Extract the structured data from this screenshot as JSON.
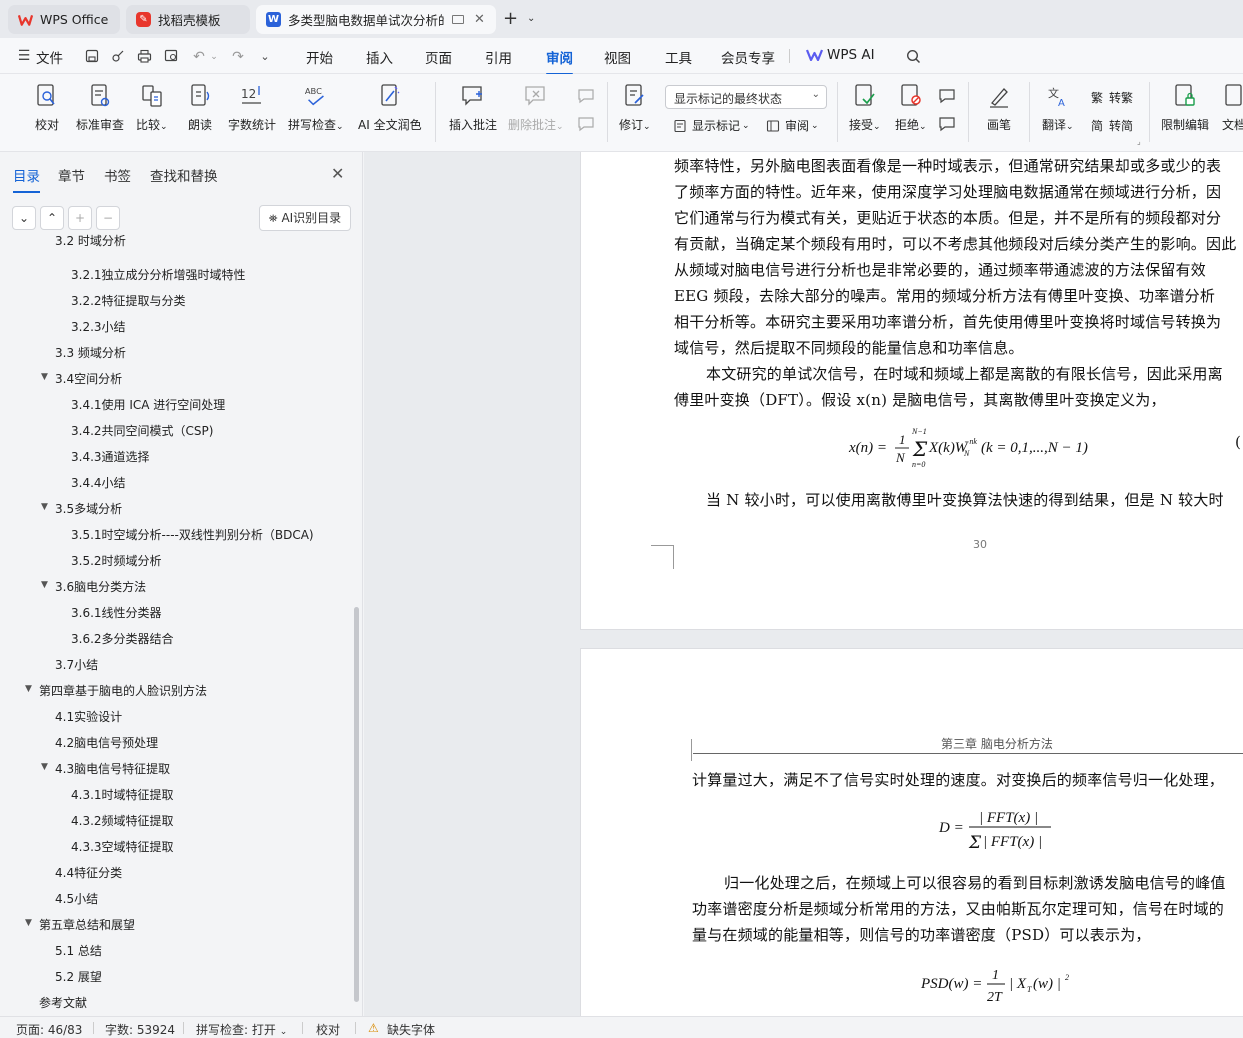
{
  "tabs": [
    {
      "label": "WPS Office",
      "icon": "wps-logo-icon"
    },
    {
      "label": "找稻壳模板",
      "icon": "docer-icon"
    },
    {
      "label": "多类型脑电数据单试次分析的",
      "icon": "word-doc-icon"
    }
  ],
  "menu": {
    "file": "文件",
    "items": [
      "开始",
      "插入",
      "页面",
      "引用",
      "审阅",
      "视图",
      "工具",
      "会员专享"
    ],
    "active": "审阅",
    "wps_ai": "WPS AI"
  },
  "ribbon": {
    "proofread": "校对",
    "standard_review": "标准审查",
    "compare": "比较",
    "read_aloud": "朗读",
    "word_count": "字数统计",
    "spell_check": "拼写检查",
    "ai_polish": "AI 全文润色",
    "insert_comment": "插入批注",
    "delete_comment": "删除批注",
    "revise": "修订",
    "display_select": "显示标记的最终状态",
    "show_marks": "显示标记",
    "review": "审阅",
    "accept": "接受",
    "reject": "拒绝",
    "pen": "画笔",
    "translate": "翻译",
    "to_traditional": "转繁",
    "to_simplified": "转简",
    "restrict_edit": "限制编辑",
    "doc_right": "文档"
  },
  "panel": {
    "tabs": [
      "目录",
      "章节",
      "书签",
      "查找和替换"
    ],
    "ai_toc": "AI识别目录",
    "toc": [
      {
        "text": "3.2 时域分析",
        "level": 2,
        "caret": false,
        "clipped": true
      },
      {
        "text": "3.2.1独立成分分析增强时域特性",
        "level": 3
      },
      {
        "text": "3.2.2特征提取与分类",
        "level": 3
      },
      {
        "text": "3.2.3小结",
        "level": 3
      },
      {
        "text": "3.3  频域分析",
        "level": 2
      },
      {
        "text": "3.4空间分析",
        "level": 2,
        "caret": true
      },
      {
        "text": "3.4.1使用 ICA 进行空间处理",
        "level": 3
      },
      {
        "text": "3.4.2共同空间模式（CSP)",
        "level": 3
      },
      {
        "text": "3.4.3通道选择",
        "level": 3
      },
      {
        "text": "3.4.4小结",
        "level": 3
      },
      {
        "text": "3.5多域分析",
        "level": 2,
        "caret": true
      },
      {
        "text": "3.5.1时空域分析----双线性判别分析（BDCA)",
        "level": 3
      },
      {
        "text": "3.5.2时频域分析",
        "level": 3
      },
      {
        "text": "3.6脑电分类方法",
        "level": 2,
        "caret": true
      },
      {
        "text": "3.6.1线性分类器",
        "level": 3
      },
      {
        "text": "3.6.2多分类器结合",
        "level": 3
      },
      {
        "text": "3.7小结",
        "level": 2
      },
      {
        "text": "第四章基于脑电的人脸识别方法",
        "level": 1,
        "caret": true
      },
      {
        "text": "4.1实验设计",
        "level": 2
      },
      {
        "text": "4.2脑电信号预处理",
        "level": 2
      },
      {
        "text": "4.3脑电信号特征提取",
        "level": 2,
        "caret": true
      },
      {
        "text": "4.3.1时域特征提取",
        "level": 3
      },
      {
        "text": "4.3.2频域特征提取",
        "level": 3
      },
      {
        "text": "4.3.3空域特征提取",
        "level": 3
      },
      {
        "text": "4.4特征分类",
        "level": 2
      },
      {
        "text": "4.5小结",
        "level": 2
      },
      {
        "text": "第五章总结和展望",
        "level": 1,
        "caret": true
      },
      {
        "text": "5.1  总结",
        "level": 2
      },
      {
        "text": "5.2  展望",
        "level": 2
      },
      {
        "text": "参考文献",
        "level": 1
      }
    ]
  },
  "doc": {
    "page1_lines": [
      "频率特性，另外脑电图表面看像是一种时域表示，但通常研究结果却或多或少的表",
      "了频率方面的特性。近年来，使用深度学习处理脑电数据通常在频域进行分析，因",
      "它们通常与行为模式有关，更贴近于状态的本质。但是，并不是所有的频段都对分",
      "有贡献，当确定某个频段有用时，可以不考虑其他频段对后续分类产生的影响。因此",
      "从频域对脑电信号进行分析也是非常必要的，通过频率带通滤波的方法保留有效",
      "EEG 频段，去除大部分的噪声。常用的频域分析方法有傅里叶变换、功率谱分析",
      "相干分析等。本研究主要采用功率谱分析，首先使用傅里叶变换将时域信号转换为",
      "域信号，然后提取不同频段的能量信息和功率信息。",
      "本文研究的单试次信号，在时域和频域上都是离散的有限长信号，因此采用离",
      "傅里叶变换（DFT）。假设 x(n) 是脑电信号，其离散傅里叶变换定义为，"
    ],
    "formula1": "x(n) = 1/N Σ X(k)W_N^-nk (k = 0,1,...,N−1)",
    "formula1_num": "(",
    "page1_after": "当 N 较小时，可以使用离散傅里叶变换算法快速的得到结果，但是 N 较大时",
    "page_number": "30",
    "page2_header": "第三章  脑电分析方法",
    "page2_line1": "计算量过大，满足不了信号实时处理的速度。对变换后的频率信号归一化处理，",
    "formula2": "D = |FFT(x)| / Σ|FFT(x)|",
    "page2_lines": [
      "归一化处理之后，在频域上可以很容易的看到目标刺激诱发脑电信号的峰值",
      "功率谱密度分析是频域分析常用的方法，又由帕斯瓦尔定理可知，信号在时域的",
      "量与在频域的能量相等，则信号的功率谱密度（PSD）可以表示为，"
    ],
    "formula3": "PSD(w) = 1/2T |X_T(w)|^2"
  },
  "status": {
    "page": "页面: 46/83",
    "words": "字数: 53924",
    "spell": "拼写检查: 打开",
    "proof": "校对",
    "missing_font": "缺失字体"
  },
  "colors": {
    "accent": "#1463d6",
    "wps_red": "#e8362c",
    "word_blue": "#2b62d9"
  }
}
